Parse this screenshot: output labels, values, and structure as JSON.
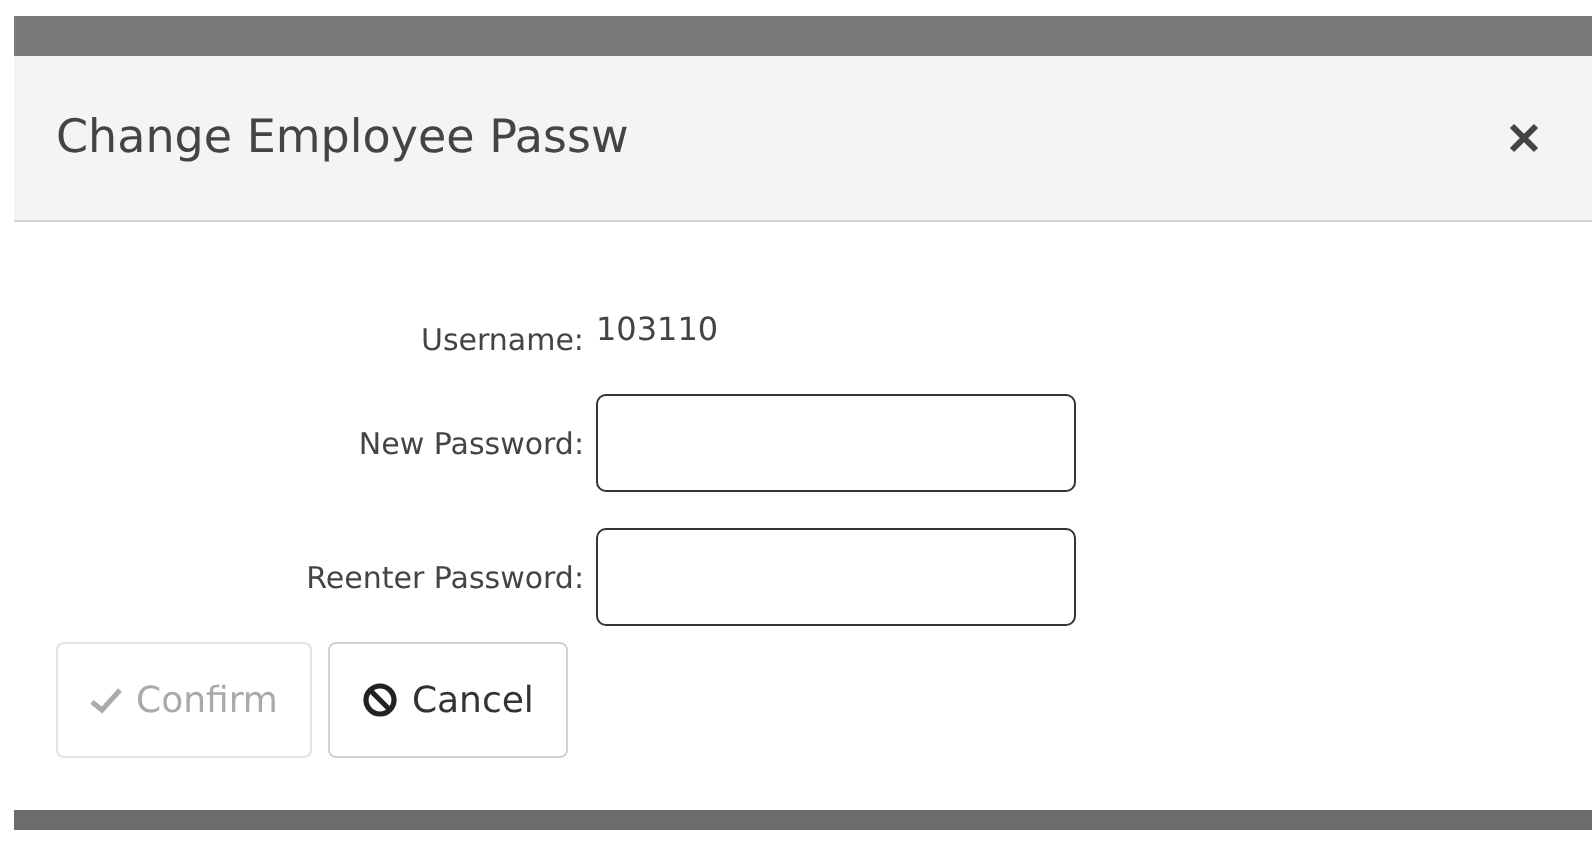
{
  "dialog": {
    "title": "Change Employee Passw",
    "fields": [
      {
        "kind": "text",
        "label": "Username:",
        "value": "103110"
      },
      {
        "kind": "input",
        "label": "New Password:"
      },
      {
        "kind": "input",
        "label": "Reenter Password:"
      }
    ],
    "buttons": [
      {
        "kind": "confirm",
        "label": "Confirm",
        "disabled": true
      },
      {
        "kind": "cancel",
        "label": "Cancel",
        "disabled": false
      }
    ]
  }
}
